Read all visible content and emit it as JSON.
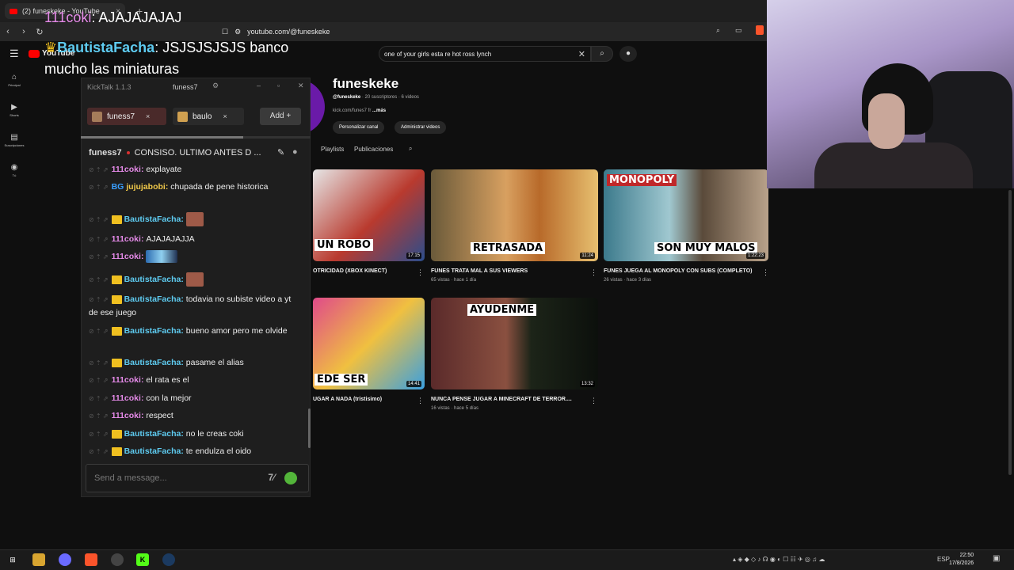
{
  "browser": {
    "tab_title": "(2) funeskeke - YouTube",
    "new_tab": "+",
    "url": "youtube.com/@funeskeke"
  },
  "youtube": {
    "logo_text": "YouTube",
    "search_query": "one of your girls esta re hot ross lynch",
    "sidebar": [
      {
        "label": "Principal",
        "icon": "home-icon"
      },
      {
        "label": "Shorts",
        "icon": "shorts-icon"
      },
      {
        "label": "Suscripciones",
        "icon": "subscriptions-icon"
      },
      {
        "label": "Tú",
        "icon": "you-icon"
      }
    ],
    "channel": {
      "name": "funeskeke",
      "handle": "@funeskeke",
      "subs": " · 20 suscriptores · 6 videos",
      "link": "kick.com/funes7 fr ",
      "more": "...más",
      "customize_button": "Personalizar canal",
      "manage_button": "Administrar videos",
      "tabs": [
        "Playlists",
        "Publicaciones"
      ]
    },
    "videos": [
      {
        "thumb_text": "UN ROBO",
        "duration": "17:15",
        "title": "OTRICIDAD (XBOX KINECT)",
        "meta": ""
      },
      {
        "thumb_text": "RETRASADA",
        "duration": "11:24",
        "title": "FUNES TRATA MAL A SUS VIEWERS",
        "meta": "65 vistas · hace 1 día"
      },
      {
        "thumb_text": "SON MUY MALOS",
        "duration": "1:22:23",
        "title": "FUNES JUEGA AL MONOPOLY CON SUBS (COMPLETO)",
        "meta": "26 vistas · hace 3 días",
        "badge": "MONOPOLY"
      },
      {
        "thumb_text": "EDE SER",
        "duration": "14:41",
        "title": "UGAR A NADA (tristisimo)",
        "meta": ""
      },
      {
        "thumb_text": "AYUDENME",
        "duration": "13:32",
        "title": "NUNCA PENSE JUGAR A MINECRAFT DE TERROR....",
        "meta": "16 vistas · hace 5 días"
      }
    ]
  },
  "overlay": {
    "line1_user": "111coki",
    "line1_text": ": AJAJAJAJAJ",
    "line2_user": "BautistaFacha",
    "line2_text": ": JSJSJSJSJS banco mucho las miniaturas"
  },
  "kicktalk": {
    "title": "KickTalk 1.1.3",
    "window_user": "funess7",
    "tabs": [
      {
        "label": "funess7",
        "close": "×"
      },
      {
        "label": "baulo",
        "close": "×"
      }
    ],
    "add_label": "Add",
    "stream_user": "funess7",
    "stream_title": "CONSISO. ULTIMO ANTES D ...",
    "messages": [
      {
        "user": "111coki",
        "text": "explayate",
        "cls": "u1"
      },
      {
        "user": "jujujabobi",
        "text": "chupada de pene historica",
        "cls": "u3",
        "badge": "BG"
      },
      {
        "user": "BautistaFacha",
        "text": "",
        "cls": "u2",
        "emote": true
      },
      {
        "user": "111coki",
        "text": "AJAJAJAJJA",
        "cls": "u1"
      },
      {
        "user": "111coki",
        "text": "",
        "cls": "u1",
        "emote2": true
      },
      {
        "user": "BautistaFacha",
        "text": "",
        "cls": "u2",
        "emote": true
      },
      {
        "user": "BautistaFacha",
        "text": "todavia no subiste video a yt de ese juego",
        "cls": "u2"
      },
      {
        "user": "BautistaFacha",
        "text": "bueno amor pero me olvide",
        "cls": "u2"
      },
      {
        "user": "BautistaFacha",
        "text": "pasame el alias",
        "cls": "u2"
      },
      {
        "user": "111coki",
        "text": "el rata es el",
        "cls": "u1"
      },
      {
        "user": "111coki",
        "text": "con la mejor",
        "cls": "u1"
      },
      {
        "user": "111coki",
        "text": "respect",
        "cls": "u1"
      },
      {
        "user": "BautistaFacha",
        "text": "no le creas coki",
        "cls": "u2"
      },
      {
        "user": "BautistaFacha",
        "text": "te endulza el oido",
        "cls": "u2"
      }
    ],
    "input_placeholder": "Send a message..."
  },
  "taskbar": {
    "lang": "ESP",
    "time": "22:50",
    "date": "17/8/2026"
  }
}
